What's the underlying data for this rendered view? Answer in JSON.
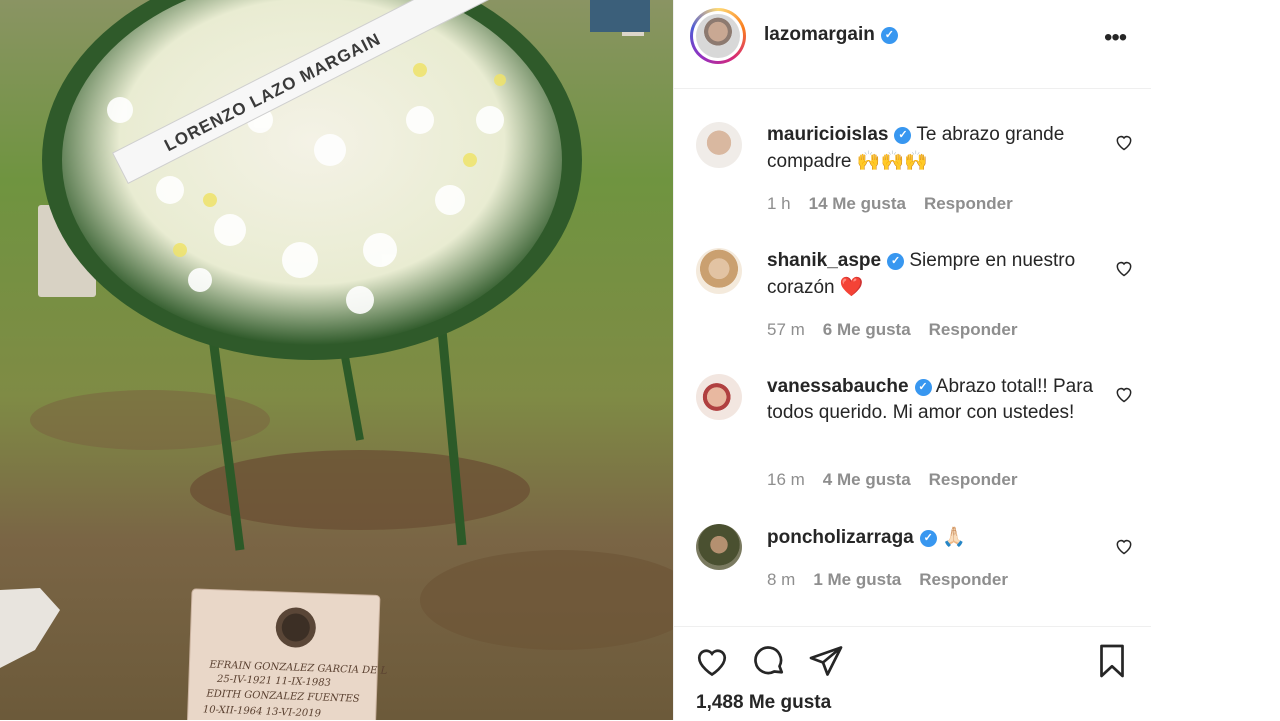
{
  "post": {
    "username": "lazomargain",
    "verified_badge": "✓",
    "more_icon": "more-horizontal-icon",
    "likes_label": "1,488 Me gusta",
    "photo": {
      "ribbon_text": "LORENZO LAZO MARGAIN",
      "plaque_lines": [
        "EFRAIN GONZALEZ GARCIA DE L",
        "25-IV-1921 11-IX-1983",
        "EDITH GONZALEZ FUENTES",
        "10-XII-1964 13-VI-2019"
      ]
    }
  },
  "comments": [
    {
      "username": "mauricioislas",
      "text": "Te abrazo grande compadre",
      "emoji": "🙌🙌🙌",
      "time": "1 h",
      "likes": "14 Me gusta",
      "reply": "Responder"
    },
    {
      "username": "shanik_aspe",
      "text": "Siempre en nuestro corazón",
      "emoji": "❤️",
      "time": "57 m",
      "likes": "6 Me gusta",
      "reply": "Responder"
    },
    {
      "username": "vanessabauche",
      "text": "Abrazo total!! Para todos querido. Mi amor con ustedes!",
      "emoji": "",
      "time": "16 m",
      "likes": "4 Me gusta",
      "reply": "Responder"
    },
    {
      "username": "poncholizarraga",
      "text": "",
      "emoji": "🙏🏻",
      "time": "8 m",
      "likes": "1 Me gusta",
      "reply": "Responder"
    }
  ],
  "icons": {
    "like": "heart-icon",
    "comment": "comment-icon",
    "share": "send-icon",
    "save": "bookmark-icon"
  },
  "colors": {
    "verified": "#3897f0",
    "text": "#262626",
    "meta": "#8e8e8e",
    "heart_emoji": "#e0245e"
  }
}
